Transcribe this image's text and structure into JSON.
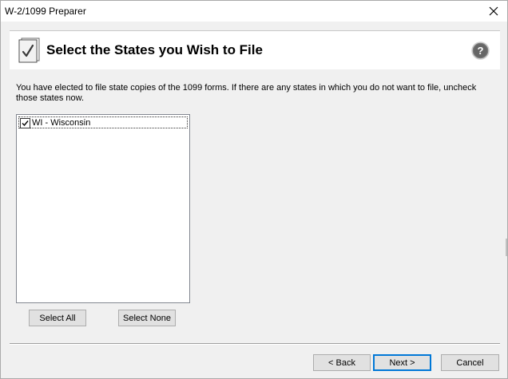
{
  "window": {
    "title": "W-2/1099 Preparer"
  },
  "icons": {
    "close": "close-icon",
    "help": "help-icon",
    "header": "checklist-icon",
    "check": "checkmark-icon"
  },
  "header": {
    "title": "Select the States you Wish to File"
  },
  "intro": {
    "text": "You have elected to file state copies of the 1099 forms. If there are any states in which you do not want to file, uncheck those states now."
  },
  "states": {
    "items": [
      {
        "label": "WI - Wisconsin",
        "checked": true
      }
    ]
  },
  "buttons": {
    "select_all": "Select All",
    "select_none": "Select None",
    "back": "< Back",
    "next": "Next >",
    "cancel": "Cancel"
  },
  "colors": {
    "accent": "#0078d7",
    "window_bg": "#f0f0f0",
    "help_icon": "#6e6e6e"
  }
}
